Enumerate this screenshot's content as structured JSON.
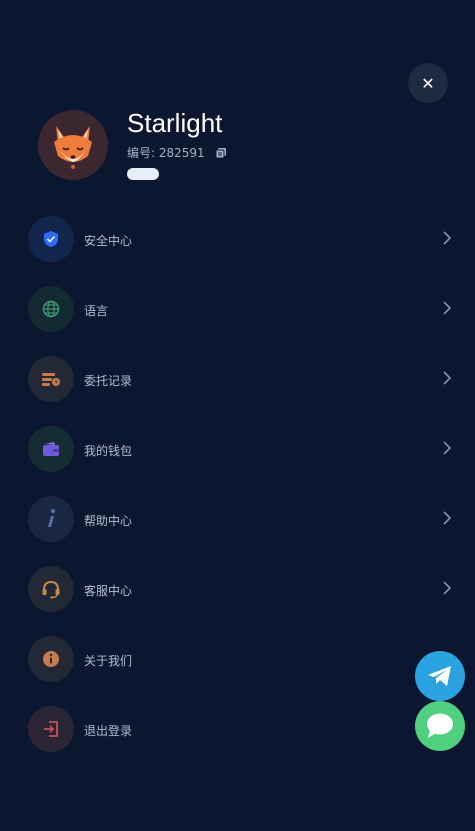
{
  "profile": {
    "name": "Starlight",
    "uid_text": "编号: 282591",
    "badge": " "
  },
  "menu": {
    "items": [
      {
        "label": "安全中心",
        "icon": "shield-check-icon",
        "bg": "#12254d",
        "has_arrow": true
      },
      {
        "label": "语言",
        "icon": "globe-icon",
        "bg": "#142a33",
        "has_arrow": true
      },
      {
        "label": "委托记录",
        "icon": "order-record-icon",
        "bg": "#222836",
        "has_arrow": true
      },
      {
        "label": "我的钱包",
        "icon": "wallet-icon",
        "bg": "#152c32",
        "has_arrow": true
      },
      {
        "label": "帮助中心",
        "icon": "info-italic-icon",
        "bg": "#1a2744",
        "has_arrow": true
      },
      {
        "label": "客服中心",
        "icon": "headset-icon",
        "bg": "#222836",
        "has_arrow": true
      },
      {
        "label": "关于我们",
        "icon": "info-circle-icon",
        "bg": "#222836",
        "has_arrow": false
      },
      {
        "label": "退出登录",
        "icon": "logout-icon",
        "bg": "#2a2434",
        "has_arrow": false
      }
    ]
  },
  "colors": {
    "background": "#0b1730",
    "telegram": "#2aa3e0",
    "chat": "#4fcf7f",
    "shield": "#2d6bff",
    "globe": "#3e9c76",
    "record": "#c77a4a",
    "wallet": "#6f5bd6",
    "help": "#5a6fb3",
    "headset": "#c58b4a",
    "about": "#c77a4a",
    "logout": "#c4515c"
  }
}
